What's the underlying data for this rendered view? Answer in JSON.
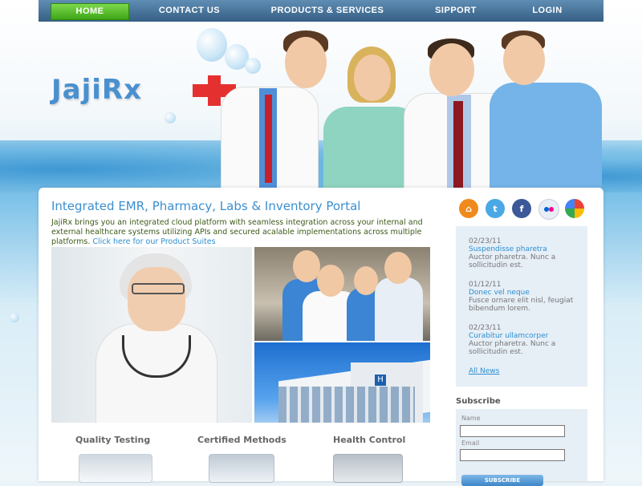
{
  "nav": {
    "items": [
      {
        "label": "HOME",
        "active": true
      },
      {
        "label": "CONTACT US"
      },
      {
        "label": "PRODUCTS & SERVICES"
      },
      {
        "label": "SIPPORT"
      },
      {
        "label": "LOGIN"
      }
    ]
  },
  "header": {
    "logo_text": "JajiRx",
    "accent_color": "#e53030",
    "brand_color": "#4a90cf"
  },
  "main": {
    "title": "Integrated EMR, Pharmacy, Labs & Inventory Portal",
    "intro": "JajiRx brings you an integrated cloud platform with seamless integration across your internal and external healthcare systems utilizing APIs and secured acalable implementations across multiple platforms.",
    "intro_link": "Click here for our Product Suites",
    "features": [
      {
        "label": "Quality Testing"
      },
      {
        "label": "Certified Methods"
      },
      {
        "label": "Health Control"
      }
    ]
  },
  "sidebar": {
    "social_icons": [
      "rss-icon",
      "twitter-icon",
      "facebook-icon",
      "flickr-icon",
      "google-icon"
    ],
    "news": [
      {
        "date": "02/23/11",
        "title": "Suspendisse pharetra",
        "body": "Auctor pharetra. Nunc a sollicitudin est."
      },
      {
        "date": "01/12/11",
        "title": "Donec vel neque",
        "body": "Fusce ornare elit nisl, feugiat bibendum lorem."
      },
      {
        "date": "02/23/11",
        "title": "Curabitur ullamcorper",
        "body": "Auctor pharetra. Nunc a sollicitudin est."
      }
    ],
    "all_news": "All News",
    "subscribe": {
      "title": "Subscribe",
      "name_label": "Name",
      "email_label": "Email",
      "button": "SUBSCRIBE"
    }
  }
}
